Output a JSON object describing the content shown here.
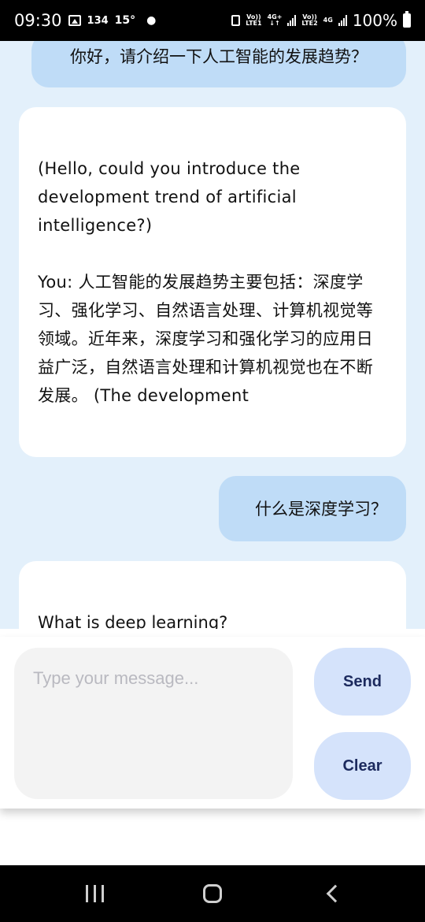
{
  "status_bar": {
    "time": "09:30",
    "notif_count": "134",
    "temperature": "15°",
    "sim1_top": "Vo))",
    "sim1_bottom": "LTE1",
    "net1": "4G+",
    "sim2_top": "Vo))",
    "sim2_bottom": "LTE2",
    "net2": "4G",
    "battery": "100%"
  },
  "chat": {
    "messages": [
      {
        "role": "user",
        "text": "你好，请介绍一下人工智能的发展趋势？"
      },
      {
        "role": "assistant",
        "text": "(Hello, could you introduce the development trend of artificial intelligence?)\n\nYou: 人工智能的发展趋势主要包括：深度学习、强化学习、自然语言处理、计算机视觉等领域。近年来，深度学习和强化学习的应用日益广泛，自然语言处理和计算机视觉也在不断发展。 (The development"
      },
      {
        "role": "user",
        "text": "什么是深度学习？"
      },
      {
        "role": "assistant",
        "text": "What is deep learning?"
      }
    ]
  },
  "input": {
    "placeholder": "Type your message...",
    "value": ""
  },
  "buttons": {
    "send_label": "Send",
    "clear_label": "Clear"
  },
  "colors": {
    "chat_background": "#e3f0fb",
    "user_bubble": "#bfdcf7",
    "assistant_bubble": "#ffffff",
    "button_background": "#d5e3fb",
    "button_text": "#1c2a5e"
  },
  "nav_bar": {
    "icons": [
      "recent-apps-icon",
      "home-icon",
      "back-icon"
    ]
  }
}
